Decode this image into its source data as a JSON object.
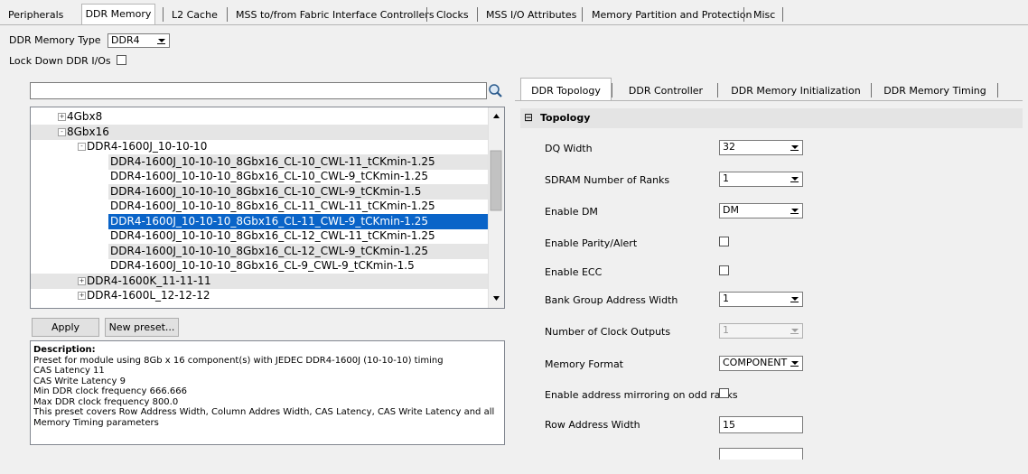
{
  "top_tabs": [
    "Peripherals",
    "DDR Memory",
    "L2 Cache",
    "MSS to/from Fabric Interface Controllers",
    "Clocks",
    "MSS I/O Attributes",
    "Memory Partition and Protection",
    "Misc"
  ],
  "active_top_tab": "DDR Memory",
  "ddr_memory_type": {
    "label": "DDR Memory Type",
    "value": "DDR4"
  },
  "lock_down": {
    "label": "Lock Down DDR I/Os",
    "checked": false
  },
  "search": {
    "value": "",
    "placeholder": ""
  },
  "tree": [
    {
      "label": "4Gbx8",
      "level": 1,
      "expander": "+"
    },
    {
      "label": "8Gbx16",
      "level": 1,
      "expander": "-"
    },
    {
      "label": "DDR4-1600J_10-10-10",
      "level": 2,
      "expander": "-"
    },
    {
      "label": "DDR4-1600J_10-10-10_8Gbx16_CL-10_CWL-11_tCKmin-1.25",
      "level": 3
    },
    {
      "label": "DDR4-1600J_10-10-10_8Gbx16_CL-10_CWL-9_tCKmin-1.25",
      "level": 3
    },
    {
      "label": "DDR4-1600J_10-10-10_8Gbx16_CL-10_CWL-9_tCKmin-1.5",
      "level": 3
    },
    {
      "label": "DDR4-1600J_10-10-10_8Gbx16_CL-11_CWL-11_tCKmin-1.25",
      "level": 3
    },
    {
      "label": "DDR4-1600J_10-10-10_8Gbx16_CL-11_CWL-9_tCKmin-1.25",
      "level": 3,
      "selected": true
    },
    {
      "label": "DDR4-1600J_10-10-10_8Gbx16_CL-12_CWL-11_tCKmin-1.25",
      "level": 3
    },
    {
      "label": "DDR4-1600J_10-10-10_8Gbx16_CL-12_CWL-9_tCKmin-1.25",
      "level": 3
    },
    {
      "label": "DDR4-1600J_10-10-10_8Gbx16_CL-9_CWL-9_tCKmin-1.5",
      "level": 3
    },
    {
      "label": "DDR4-1600K_11-11-11",
      "level": 2,
      "expander": "+"
    },
    {
      "label": "DDR4-1600L_12-12-12",
      "level": 2,
      "expander": "+"
    }
  ],
  "buttons": {
    "apply": "Apply",
    "new_preset": "New preset..."
  },
  "description": {
    "heading": "Description:",
    "lines": [
      "Preset for module using 8Gb x 16 component(s) with JEDEC DDR4-1600J (10-10-10) timing",
      "CAS Latency 11",
      "CAS Write Latency 9",
      "Min DDR clock frequency 666.666",
      "Max DDR clock frequency 800.0",
      "This preset covers Row Address Width, Column Addres Width, CAS Latency, CAS Write Latency and all",
      "Memory Timing parameters"
    ]
  },
  "right_tabs": [
    "DDR Topology",
    "DDR Controller",
    "DDR Memory Initialization",
    "DDR Memory Timing"
  ],
  "active_right_tab": "DDR Topology",
  "section": {
    "expander": "⊟",
    "title": "Topology"
  },
  "fields": [
    {
      "label": "DQ Width",
      "type": "combo",
      "value": "32"
    },
    {
      "label": "SDRAM Number of Ranks",
      "type": "combo",
      "value": "1"
    },
    {
      "label": "Enable DM",
      "type": "combo",
      "value": "DM"
    },
    {
      "label": "Enable Parity/Alert",
      "type": "checkbox",
      "checked": false
    },
    {
      "label": "Enable ECC",
      "type": "checkbox",
      "checked": false
    },
    {
      "label": "Bank Group Address Width",
      "type": "combo",
      "value": "1"
    },
    {
      "label": "Number of Clock Outputs",
      "type": "combo",
      "value": "1",
      "disabled": true
    },
    {
      "label": "Memory Format",
      "type": "combo",
      "value": "COMPONENT"
    },
    {
      "label": "Enable address mirroring on odd ranks",
      "type": "checkbox",
      "checked": false
    },
    {
      "label": "Row Address Width",
      "type": "text",
      "value": "15"
    }
  ],
  "colors": {
    "selection": "#0a64c8",
    "alt_row": "#e5e5e5",
    "panel": "#f0f0f0"
  }
}
